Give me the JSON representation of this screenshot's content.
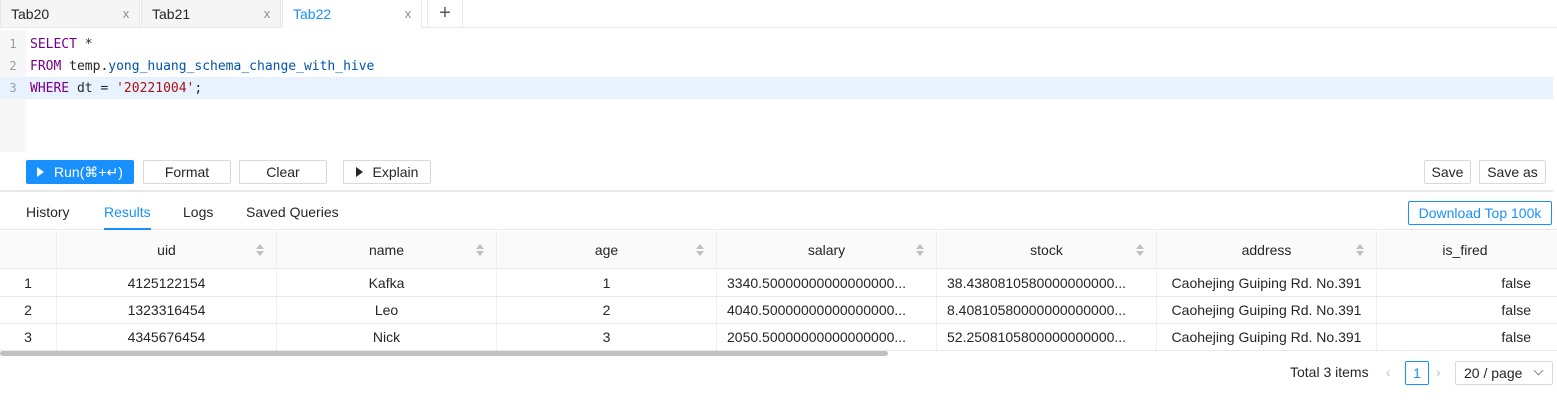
{
  "tabs": [
    {
      "label": "Tab20",
      "close": "x"
    },
    {
      "label": "Tab21",
      "close": "x"
    },
    {
      "label": "Tab22",
      "close": "x",
      "active": true
    }
  ],
  "add_tab": "+",
  "editor": {
    "line_numbers": [
      "1",
      "2",
      "3"
    ],
    "lines": [
      {
        "kw": "SELECT",
        "rest": " *"
      },
      {
        "kw": "FROM",
        "plain": " temp.",
        "table": "yong_huang_schema_change_with_hive"
      },
      {
        "kw": "WHERE",
        "plain": " dt = ",
        "str": "'20221004'",
        "end": ";"
      }
    ]
  },
  "toolbar": {
    "run_label": "Run(⌘+↵)",
    "format_label": "Format",
    "clear_label": "Clear",
    "explain_label": "Explain",
    "save_label": "Save",
    "save_as_label": "Save as"
  },
  "result_tabs": {
    "history": "History",
    "results": "Results",
    "logs": "Logs",
    "saved_queries": "Saved Queries",
    "download_label": "Download Top 100k"
  },
  "table": {
    "columns": [
      "uid",
      "name",
      "age",
      "salary",
      "stock",
      "address",
      "is_fired"
    ],
    "rows": [
      {
        "index": "1",
        "uid": "4125122154",
        "name": "Kafka",
        "age": "1",
        "salary": "3340.50000000000000000...",
        "stock": "38.4380810580000000000...",
        "address": "Caohejing Guiping Rd. No.391",
        "is_fired": "false"
      },
      {
        "index": "2",
        "uid": "1323316454",
        "name": "Leo",
        "age": "2",
        "salary": "4040.50000000000000000...",
        "stock": "8.40810580000000000000...",
        "address": "Caohejing Guiping Rd. No.391",
        "is_fired": "false"
      },
      {
        "index": "3",
        "uid": "4345676454",
        "name": "Nick",
        "age": "3",
        "salary": "2050.50000000000000000...",
        "stock": "52.2508105800000000000...",
        "address": "Caohejing Guiping Rd. No.391",
        "is_fired": "false"
      }
    ]
  },
  "pagination": {
    "total": "Total 3 items",
    "prev": "‹",
    "current": "1",
    "next": "›",
    "page_size": "20 / page"
  },
  "colors": {
    "accent": "#1890ff",
    "keyword": "#770088",
    "table_name": "#0055aa",
    "string": "#aa1111"
  }
}
